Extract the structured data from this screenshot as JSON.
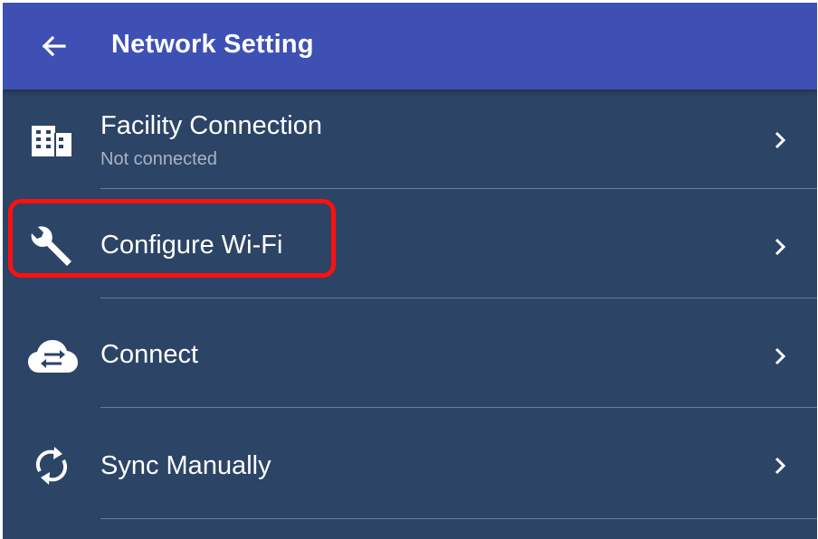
{
  "appbar": {
    "title": "Network Setting",
    "back_icon": "arrow-left-icon",
    "color": "#3e50b4"
  },
  "background_color": "#2c4466",
  "annotation_color": "#ff1010",
  "menu": [
    {
      "label": "Facility Connection",
      "sublabel": "Not connected",
      "icon": "building-icon"
    },
    {
      "label": "Configure Wi-Fi",
      "icon": "wrench-icon",
      "highlighted": true
    },
    {
      "label": "Connect",
      "icon": "cloud-sync-icon"
    },
    {
      "label": "Sync Manually",
      "icon": "sync-icon"
    }
  ]
}
